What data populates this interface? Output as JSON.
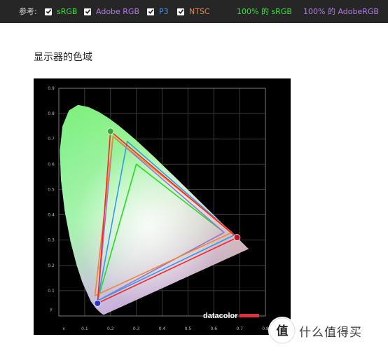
{
  "legend": {
    "prefix": "参考:",
    "items": [
      {
        "label": "sRGB",
        "color": "#3ddc3d",
        "checked": true
      },
      {
        "label": "Adobe RGB",
        "color": "#b07ce0",
        "checked": true
      },
      {
        "label": "P3",
        "color": "#4a90e2",
        "checked": true
      },
      {
        "label": "NTSC",
        "color": "#e0884a",
        "checked": true
      }
    ],
    "coverage": [
      {
        "text": "100% 的 sRGB",
        "color": "#3ddc3d"
      },
      {
        "text": "100% 的 AdobeRGB",
        "color": "#b07ce0"
      }
    ]
  },
  "section_title": "显示器的色域",
  "chart_data": {
    "type": "scatter",
    "title": "",
    "xlabel": "x",
    "ylabel": "y",
    "xlim": [
      0,
      0.8
    ],
    "ylim": [
      0,
      0.9
    ],
    "x_ticks": [
      "0.1",
      "0.2",
      "0.3",
      "0.4",
      "0.5",
      "0.6",
      "0.7",
      "0.8"
    ],
    "y_ticks": [
      "0.1",
      "0.2",
      "0.3",
      "0.4",
      "0.5",
      "0.6",
      "0.7",
      "0.8",
      "0.9"
    ],
    "grid": true,
    "brand": "datacolor",
    "series": [
      {
        "name": "sRGB",
        "color": "#22dd22",
        "points": [
          [
            0.64,
            0.33
          ],
          [
            0.3,
            0.6
          ],
          [
            0.15,
            0.06
          ]
        ]
      },
      {
        "name": "Adobe RGB",
        "color": "#a070e0",
        "points": [
          [
            0.64,
            0.33
          ],
          [
            0.21,
            0.71
          ],
          [
            0.15,
            0.06
          ]
        ]
      },
      {
        "name": "P3",
        "color": "#3399ee",
        "points": [
          [
            0.68,
            0.32
          ],
          [
            0.265,
            0.69
          ],
          [
            0.15,
            0.06
          ]
        ]
      },
      {
        "name": "NTSC",
        "color": "#ee8833",
        "points": [
          [
            0.67,
            0.33
          ],
          [
            0.21,
            0.71
          ],
          [
            0.14,
            0.08
          ]
        ]
      },
      {
        "name": "",
        "color": "#ff2222",
        "points": [
          [
            0.69,
            0.31
          ],
          [
            0.2,
            0.73
          ],
          [
            0.15,
            0.05
          ]
        ]
      }
    ],
    "markers": [
      {
        "x": 0.2,
        "y": 0.73,
        "color": "#33aa33"
      },
      {
        "x": 0.69,
        "y": 0.31,
        "color": "#cc1122"
      },
      {
        "x": 0.15,
        "y": 0.05,
        "color": "#2233cc"
      }
    ]
  },
  "watermark": {
    "icon": "值",
    "text": "什么值得买"
  }
}
